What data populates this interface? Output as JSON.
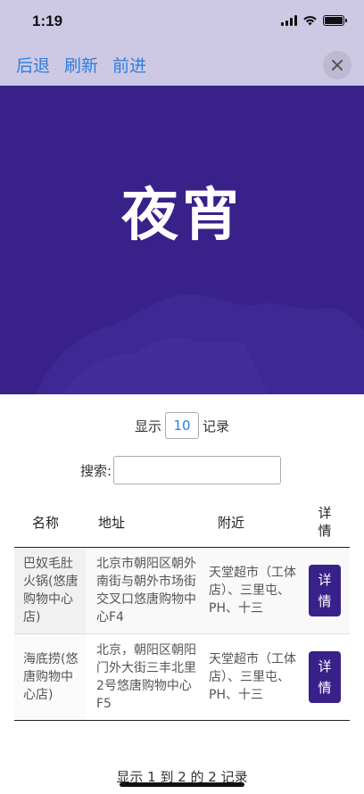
{
  "status": {
    "time": "1:19"
  },
  "nav": {
    "back": "后退",
    "refresh": "刷新",
    "forward": "前进"
  },
  "hero": {
    "title": "夜宵",
    "bg_color": "#39218a"
  },
  "table_controls": {
    "length_prefix": "显示",
    "length_value": "10",
    "length_suffix": "记录",
    "search_label": "搜索:"
  },
  "table": {
    "headers": {
      "name": "名称",
      "address": "地址",
      "nearby": "附近",
      "detail": "详情"
    },
    "rows": [
      {
        "name": "巴奴毛肚火锅(悠唐购物中心店)",
        "address": "北京市朝阳区朝外南街与朝外市场街交叉口悠唐购物中心F4",
        "nearby": "天堂超市（工体店）、三里屯、PH、十三",
        "detail": "详情"
      },
      {
        "name": "海底捞(悠唐购物中心店)",
        "address": "北京，朝阳区朝阳门外大街三丰北里2号悠唐购物中心F5",
        "nearby": "天堂超市（工体店）、三里屯、PH、十三",
        "detail": "详情"
      }
    ]
  },
  "table_info": "显示 1 到 2 的 2 记录"
}
